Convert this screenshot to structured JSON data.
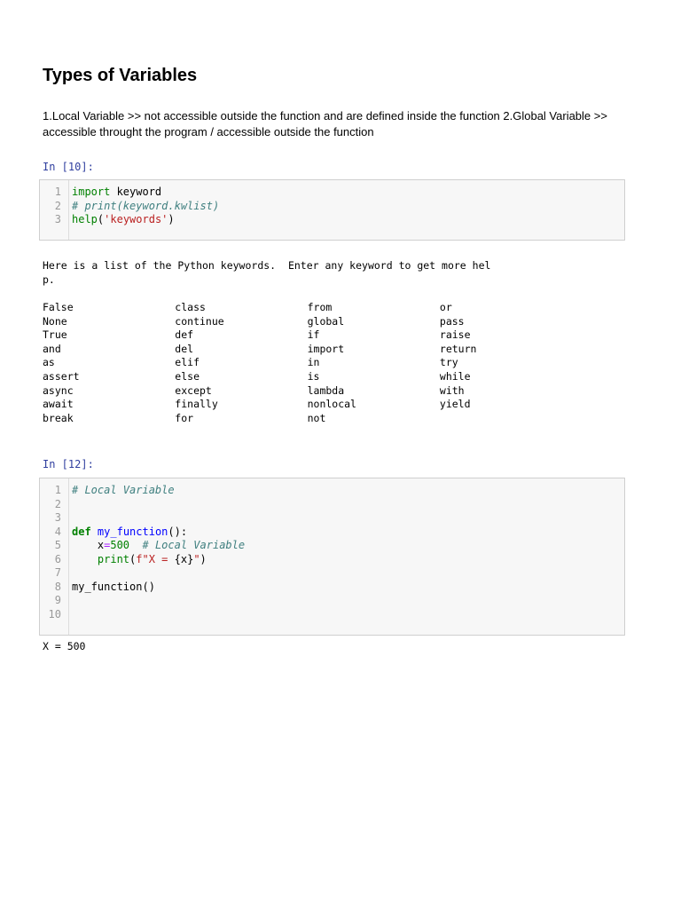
{
  "heading": "Types of Variables",
  "paragraph": "1.Local Variable >> not accessible outside the function and are defined inside the function 2.Global Variable >> accessible throught the program / accessible outside the function",
  "cells": [
    {
      "prompt": "In [10]:",
      "lines": [
        [
          {
            "t": "import",
            "c": "#008000"
          },
          {
            "t": " keyword",
            "c": "#000"
          }
        ],
        [
          {
            "t": "# print(keyword.kwlist)",
            "c": "#408080",
            "i": true
          }
        ],
        [
          {
            "t": "help",
            "c": "#008000"
          },
          {
            "t": "(",
            "c": "#000"
          },
          {
            "t": "'keywords'",
            "c": "#ba2121"
          },
          {
            "t": ")",
            "c": "#000"
          }
        ]
      ],
      "output_header": "Here is a list of the Python keywords.  Enter any keyword to get more hel\np.",
      "keywords": [
        [
          "False",
          "None",
          "True",
          "and",
          "as",
          "assert",
          "async",
          "await",
          "break"
        ],
        [
          "class",
          "continue",
          "def",
          "del",
          "elif",
          "else",
          "except",
          "finally",
          "for"
        ],
        [
          "from",
          "global",
          "if",
          "import",
          "in",
          "is",
          "lambda",
          "nonlocal",
          "not"
        ],
        [
          "or",
          "pass",
          "raise",
          "return",
          "try",
          "while",
          "with",
          "yield"
        ]
      ]
    },
    {
      "prompt": "In [12]:",
      "lines": [
        [
          {
            "t": "# Local Variable",
            "c": "#408080",
            "i": true
          }
        ],
        [],
        [],
        [
          {
            "t": "def",
            "c": "#008000",
            "b": true
          },
          {
            "t": " ",
            "c": "#000"
          },
          {
            "t": "my_function",
            "c": "#0000ff"
          },
          {
            "t": "():",
            "c": "#000"
          }
        ],
        [
          {
            "t": "    x",
            "c": "#000"
          },
          {
            "t": "=",
            "c": "#aa22ff"
          },
          {
            "t": "500",
            "c": "#008000"
          },
          {
            "t": "  ",
            "c": "#000"
          },
          {
            "t": "# Local Variable",
            "c": "#408080",
            "i": true
          }
        ],
        [
          {
            "t": "    ",
            "c": "#000"
          },
          {
            "t": "print",
            "c": "#008000"
          },
          {
            "t": "(",
            "c": "#000"
          },
          {
            "t": "f\"X = ",
            "c": "#ba2121"
          },
          {
            "t": "{x}",
            "c": "#000"
          },
          {
            "t": "\"",
            "c": "#ba2121"
          },
          {
            "t": ")",
            "c": "#000"
          }
        ],
        [],
        [
          {
            "t": "my_function()",
            "c": "#000"
          }
        ],
        [],
        []
      ],
      "output": "X = 500"
    }
  ]
}
